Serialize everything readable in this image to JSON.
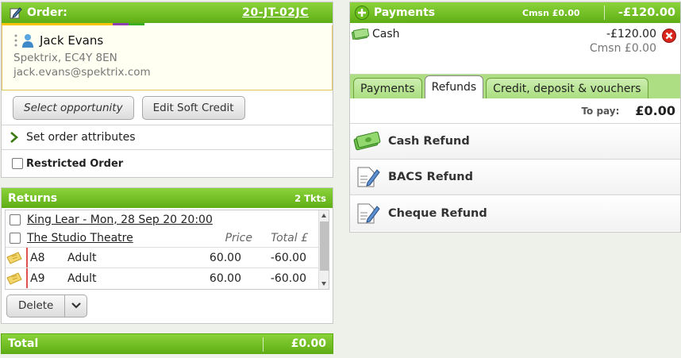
{
  "order": {
    "title": "Order:",
    "order_id": "20-JT-02JC",
    "color_strip": [
      "#f6c400",
      "#8f3fb0",
      "#3ab020"
    ],
    "customer": {
      "name": "Jack Evans",
      "address": "Spektrix, EC4Y 8EN",
      "email": "jack.evans@spektrix.com"
    },
    "buttons": {
      "select_opportunity": "Select opportunity",
      "edit_soft_credit": "Edit Soft Credit"
    },
    "set_attributes": "Set order attributes",
    "restricted_label": "Restricted Order"
  },
  "returns": {
    "title": "Returns",
    "count": "2 Tkts",
    "event": "King Lear - Mon, 28 Sep 20 20:00",
    "venue": "The Studio Theatre",
    "col_price": "Price",
    "col_total": "Total £",
    "tickets": [
      {
        "seat": "A8",
        "type": "Adult",
        "price": "60.00",
        "total": "-60.00"
      },
      {
        "seat": "A9",
        "type": "Adult",
        "price": "60.00",
        "total": "-60.00"
      }
    ],
    "delete_label": "Delete"
  },
  "total": {
    "label": "Total",
    "value": "£0.00"
  },
  "payments": {
    "title": "Payments",
    "cmsn": "Cmsn £0.00",
    "amount": "-£120.00",
    "entry": {
      "method": "Cash",
      "amount": "-£120.00",
      "cmsn": "Cmsn £0.00"
    },
    "tabs": [
      {
        "label": "Payments",
        "active": false
      },
      {
        "label": "Refunds",
        "active": true
      },
      {
        "label": "Credit, deposit & vouchers",
        "active": false
      }
    ],
    "to_pay_label": "To pay:",
    "to_pay_value": "£0.00",
    "refund_options": [
      {
        "label": "Cash Refund",
        "icon": "cash-icon"
      },
      {
        "label": "BACS Refund",
        "icon": "document-pen-icon"
      },
      {
        "label": "Cheque Refund",
        "icon": "document-pen-icon"
      }
    ]
  },
  "colors": {
    "green_top": "#8bd33a",
    "green_bottom": "#5fae15",
    "tab_bar": "#aede83",
    "remove_red": "#d9251c"
  }
}
